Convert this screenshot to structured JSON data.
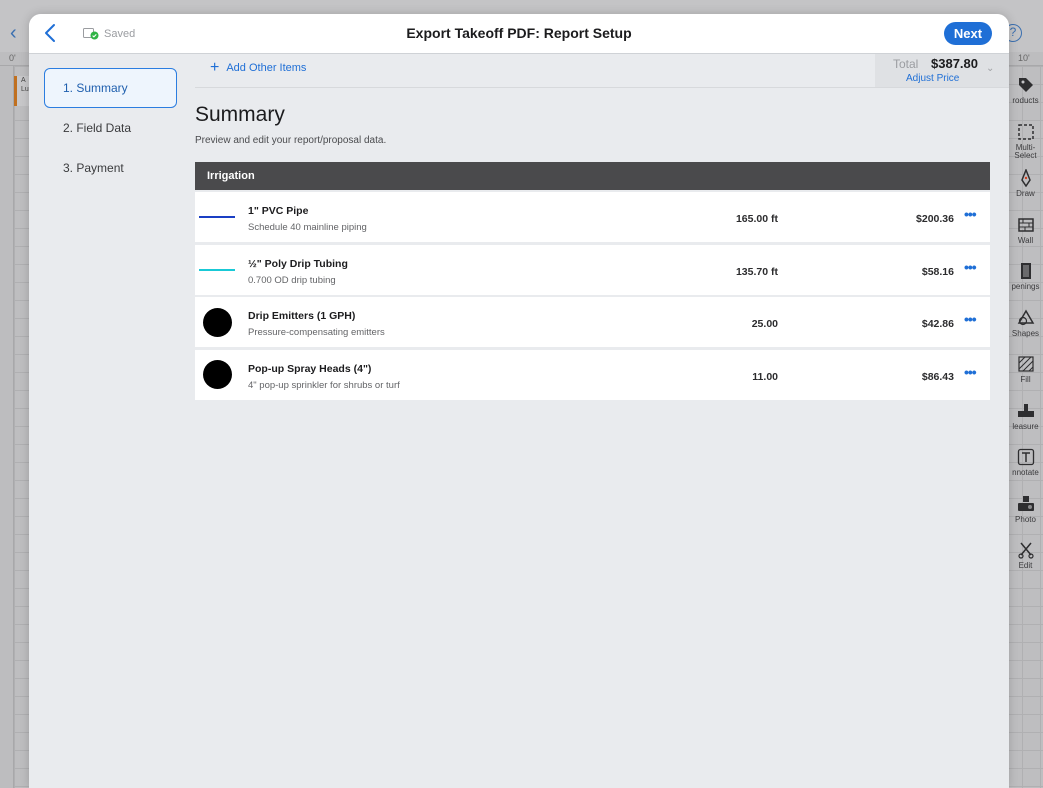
{
  "background": {
    "ruler_origin": "0'",
    "ruler_right": "10'",
    "canvas_label_top": "A",
    "canvas_label_bottom": "Lu",
    "tools": [
      {
        "label": "roducts",
        "icon": "tag-icon"
      },
      {
        "label": "Multi-Select",
        "icon": "multi-select-icon"
      },
      {
        "label": "Draw",
        "icon": "pen-icon"
      },
      {
        "label": "Wall",
        "icon": "wall-icon"
      },
      {
        "label": "penings",
        "icon": "door-icon"
      },
      {
        "label": "Shapes",
        "icon": "shapes-icon"
      },
      {
        "label": "Fill",
        "icon": "fill-icon"
      },
      {
        "label": "leasure",
        "icon": "measure-icon"
      },
      {
        "label": "nnotate",
        "icon": "text-icon"
      },
      {
        "label": "Photo",
        "icon": "camera-icon"
      },
      {
        "label": "Edit",
        "icon": "scissors-icon"
      }
    ]
  },
  "header": {
    "saved_label": "Saved",
    "title": "Export Takeoff PDF: Report Setup",
    "next_label": "Next"
  },
  "steps": [
    {
      "label": "1. Summary",
      "active": true
    },
    {
      "label": "2. Field Data",
      "active": false
    },
    {
      "label": "3. Payment",
      "active": false
    }
  ],
  "toolbar": {
    "add_other_label": "Add Other Items",
    "total_label": "Total",
    "total_value": "$387.80",
    "adjust_price_label": "Adjust Price"
  },
  "main": {
    "title": "Summary",
    "subtitle": "Preview and edit your report/proposal data."
  },
  "section": {
    "name": "Irrigation",
    "items": [
      {
        "name": "1\" PVC Pipe",
        "desc": "Schedule 40 mainline piping",
        "qty": "165.00 ft",
        "price": "$200.36",
        "swatch": "line",
        "color": "#1a3fc4"
      },
      {
        "name": "½\" Poly Drip Tubing",
        "desc": "0.700 OD drip tubing",
        "qty": "135.70 ft",
        "price": "$58.16",
        "swatch": "line",
        "color": "#19c9d6"
      },
      {
        "name": "Drip Emitters (1 GPH)",
        "desc": "Pressure-compensating emitters",
        "qty": "25.00",
        "price": "$42.86",
        "swatch": "dot",
        "color": "#000000"
      },
      {
        "name": "Pop-up Spray Heads (4\")",
        "desc": "4\" pop-up sprinkler for shrubs or turf",
        "qty": "11.00",
        "price": "$86.43",
        "swatch": "dot",
        "color": "#000000"
      }
    ]
  },
  "colors": {
    "accent": "#1f6fd6",
    "section_header": "#4a4a4c",
    "saved_ok": "#2fb344"
  }
}
